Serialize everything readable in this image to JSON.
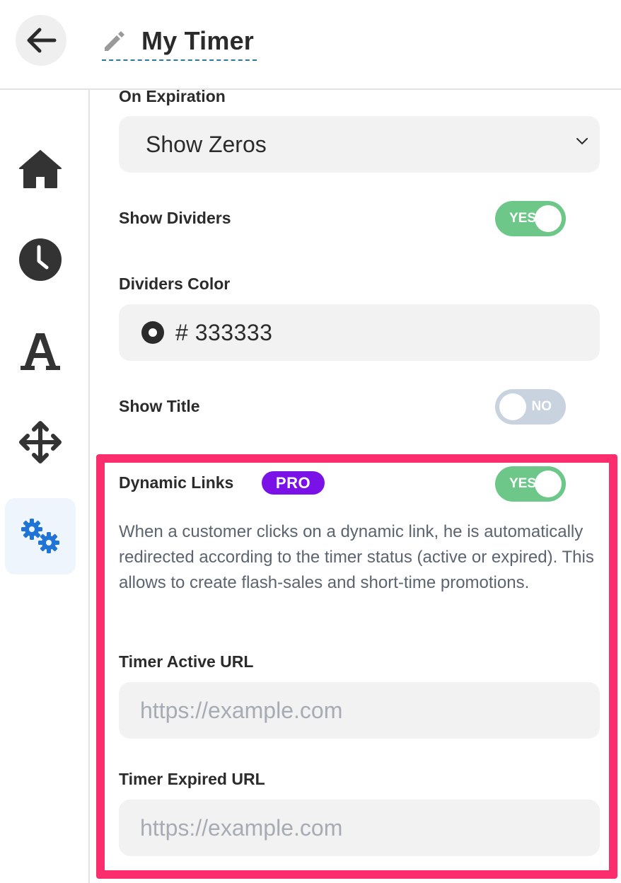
{
  "header": {
    "back_icon": "arrow-left-icon",
    "edit_icon": "pencil-icon",
    "title": "My Timer"
  },
  "sidebar": {
    "items": [
      {
        "name": "home",
        "icon": "home-icon",
        "active": false
      },
      {
        "name": "timer",
        "icon": "clock-icon",
        "active": false
      },
      {
        "name": "typography",
        "icon": "font-icon",
        "active": false
      },
      {
        "name": "layout",
        "icon": "move-icon",
        "active": false
      },
      {
        "name": "settings",
        "icon": "gears-icon",
        "active": true
      }
    ]
  },
  "settings": {
    "on_expiration": {
      "label": "On Expiration",
      "value": "Show Zeros"
    },
    "show_dividers": {
      "label": "Show Dividers",
      "toggle": "YES",
      "on": true
    },
    "dividers_color": {
      "label": "Dividers Color",
      "value": "# 333333",
      "swatch": "#2b2b2b"
    },
    "show_title": {
      "label": "Show Title",
      "toggle": "NO",
      "on": false
    },
    "dynamic_links": {
      "label": "Dynamic Links",
      "badge": "PRO",
      "toggle": "YES",
      "on": true,
      "description": "When a customer clicks on a dynamic link, he is automatically redirected according to the timer status (active or expired). This allows to create flash-sales and short-time promotions."
    },
    "timer_active_url": {
      "label": "Timer Active URL",
      "value": "",
      "placeholder": "https://example.com"
    },
    "timer_expired_url": {
      "label": "Timer Expired URL",
      "value": "",
      "placeholder": "https://example.com"
    }
  },
  "colors": {
    "toggle_on": "#6cc788",
    "toggle_off": "#c9d2df",
    "pro_badge": "#7a12e8",
    "highlight_border": "#fb2d6c",
    "active_sidebar": "#eef5fc",
    "settings_icon": "#1f74d6"
  }
}
